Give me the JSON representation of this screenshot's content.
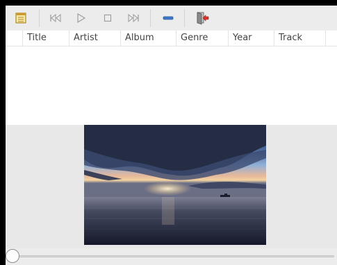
{
  "toolbar": {
    "buttons": [
      {
        "name": "playlist-button",
        "icon": "playlist-icon"
      },
      {
        "name": "previous-button",
        "icon": "skip-back-icon"
      },
      {
        "name": "play-button",
        "icon": "play-icon"
      },
      {
        "name": "stop-button",
        "icon": "stop-icon"
      },
      {
        "name": "next-button",
        "icon": "skip-forward-icon"
      },
      {
        "name": "volume-button",
        "icon": "volume-bar-icon"
      },
      {
        "name": "quit-button",
        "icon": "exit-icon"
      }
    ]
  },
  "playlist": {
    "columns": [
      "Title",
      "Artist",
      "Album",
      "Genre",
      "Year",
      "Track"
    ],
    "rows": []
  },
  "video": {
    "image_description_icon": "sunset-over-sea-image"
  },
  "seek": {
    "position": 0
  },
  "colors": {
    "toolbar_bg": "#ececec",
    "list_bg": "#ffffff",
    "accent_blue": "#3d78c9",
    "exit_red": "#d9362b"
  }
}
